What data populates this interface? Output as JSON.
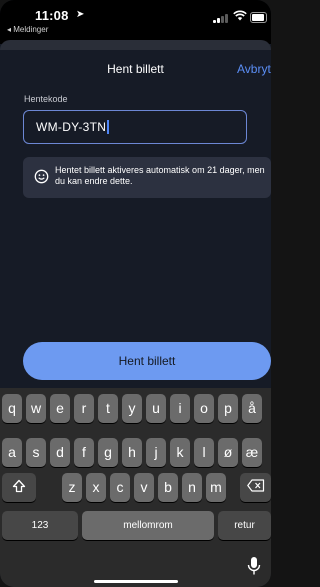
{
  "status_bar": {
    "time": "11:08",
    "back_app": "◂ Meldinger"
  },
  "header": {
    "title": "Hent billett",
    "cancel_label": "Avbryt"
  },
  "form": {
    "field_label": "Hentekode",
    "code_value": "WM-DY-3TN"
  },
  "info": {
    "text": "Hentet billett aktiveres automatisk om 21 dager, men du kan endre dette."
  },
  "primary_button": {
    "label": "Hent billett"
  },
  "keyboard": {
    "row1": [
      "q",
      "w",
      "e",
      "r",
      "t",
      "y",
      "u",
      "i",
      "o",
      "p",
      "å"
    ],
    "row2": [
      "a",
      "s",
      "d",
      "f",
      "g",
      "h",
      "j",
      "k",
      "l",
      "ø",
      "æ"
    ],
    "row3": [
      "z",
      "x",
      "c",
      "v",
      "b",
      "n",
      "m"
    ],
    "numbers_label": "123",
    "space_label": "mellomrom",
    "return_label": "retur"
  },
  "colors": {
    "accent": "#6d9af1",
    "link": "#5b8ef5",
    "background": "#161b26",
    "info_bg": "#2c3140"
  }
}
